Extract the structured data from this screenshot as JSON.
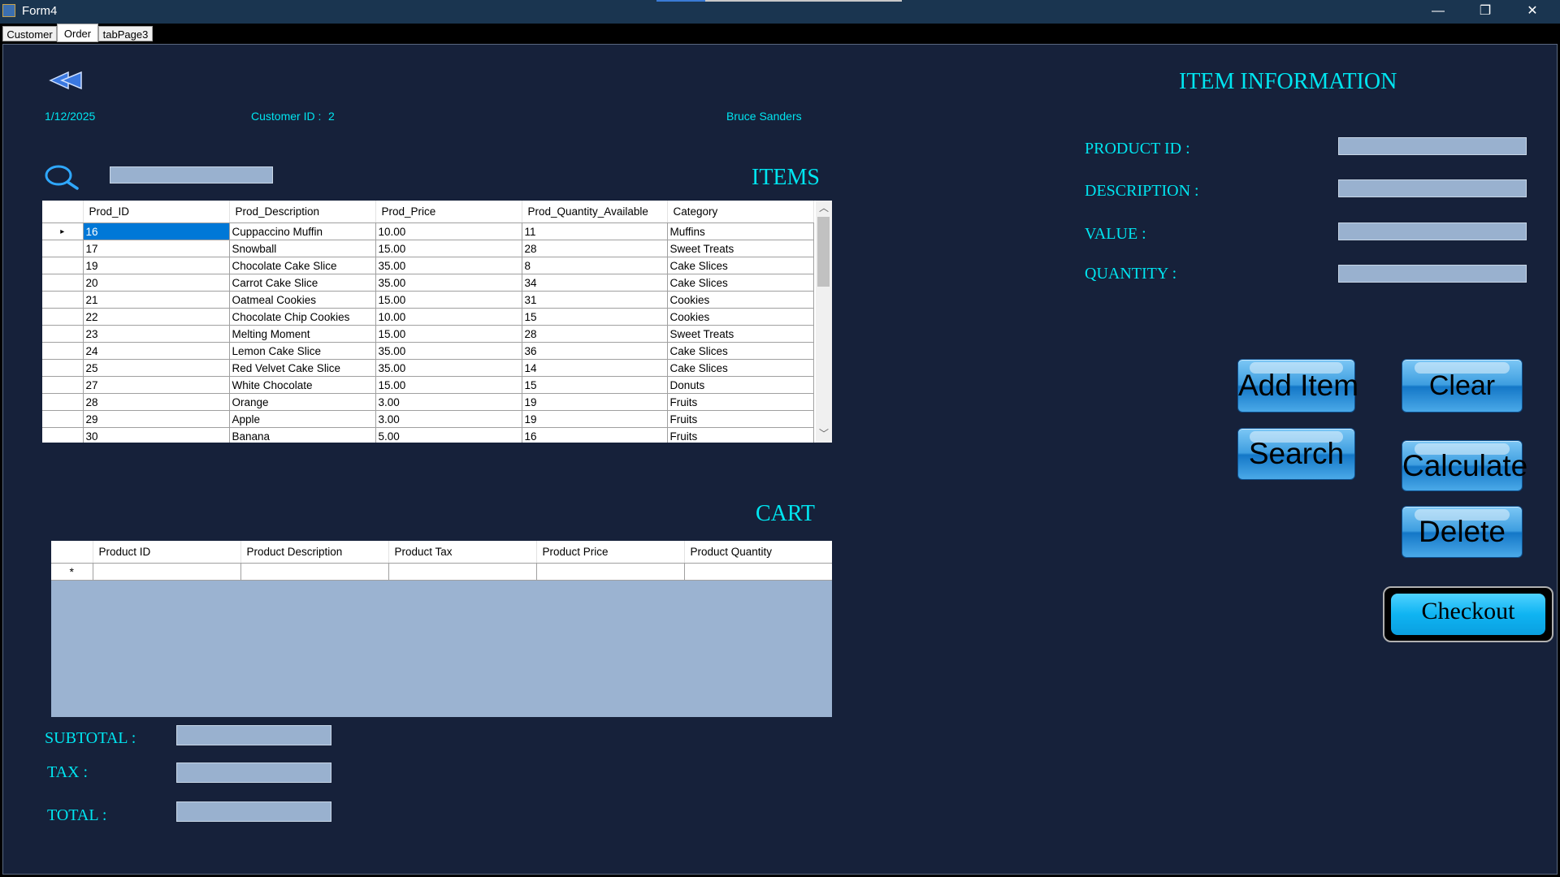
{
  "window": {
    "title": "Form4",
    "controls": {
      "minimize": "—",
      "maximize": "❐",
      "close": "✕"
    },
    "loading_progress": 0.2
  },
  "tabs": [
    {
      "label": "Customer",
      "active": false
    },
    {
      "label": "Order",
      "active": true
    },
    {
      "label": "tabPage3",
      "active": false
    }
  ],
  "header": {
    "date": "1/12/2025",
    "customer_id_label": "Customer ID :",
    "customer_id_value": "2",
    "customer_name": "Bruce Sanders",
    "back_icon": "double-arrow-left-icon"
  },
  "items": {
    "title": "ITEMS",
    "search_icon": "search-icon",
    "search_value": "",
    "columns": [
      "Prod_ID",
      "Prod_Description",
      "Prod_Price",
      "Prod_Quantity_Available",
      "Category"
    ],
    "rows": [
      [
        "16",
        "Cuppaccino Muffin",
        "10.00",
        "11",
        "Muffins"
      ],
      [
        "17",
        "Snowball",
        "15.00",
        "28",
        "Sweet Treats"
      ],
      [
        "19",
        "Chocolate Cake Slice",
        "35.00",
        "8",
        "Cake Slices"
      ],
      [
        "20",
        "Carrot Cake Slice",
        "35.00",
        "34",
        "Cake Slices"
      ],
      [
        "21",
        "Oatmeal Cookies",
        "15.00",
        "31",
        "Cookies"
      ],
      [
        "22",
        "Chocolate Chip Cookies",
        "10.00",
        "15",
        "Cookies"
      ],
      [
        "23",
        "Melting Moment",
        "15.00",
        "28",
        "Sweet Treats"
      ],
      [
        "24",
        "Lemon Cake Slice",
        "35.00",
        "36",
        "Cake Slices"
      ],
      [
        "25",
        " Red Velvet Cake Slice",
        "35.00",
        "14",
        "Cake Slices"
      ],
      [
        "27",
        "White Chocolate",
        "15.00",
        "15",
        "Donuts"
      ],
      [
        "28",
        "Orange",
        "3.00",
        "19",
        "Fruits"
      ],
      [
        "29",
        "Apple",
        "3.00",
        "19",
        "Fruits"
      ],
      [
        "30",
        "Banana",
        "5.00",
        "16",
        "Fruits"
      ]
    ],
    "selected_row_marker": "▸",
    "scroll_up": "︿",
    "scroll_down": "﹀"
  },
  "cart": {
    "title": "CART",
    "columns": [
      "Product ID",
      "Product Description",
      "Product Tax",
      "Product Price",
      "Product Quantity"
    ],
    "new_row_marker": "*"
  },
  "totals": {
    "subtotal_label": "SUBTOTAL :",
    "tax_label": "TAX :",
    "total_label": "TOTAL :",
    "subtotal_value": "",
    "tax_value": "",
    "total_value": ""
  },
  "item_info": {
    "title": "ITEM INFORMATION",
    "product_id_label": "PRODUCT ID :",
    "description_label": "DESCRIPTION :",
    "value_label": "VALUE :",
    "quantity_label": "QUANTITY :",
    "product_id_value": "",
    "description_value": "",
    "value_value": "",
    "quantity_value": ""
  },
  "buttons": {
    "add_item": "Add Item",
    "clear": "Clear",
    "search": "Search",
    "calculate": "Calculate",
    "delete": "Delete",
    "checkout": "Checkout"
  }
}
